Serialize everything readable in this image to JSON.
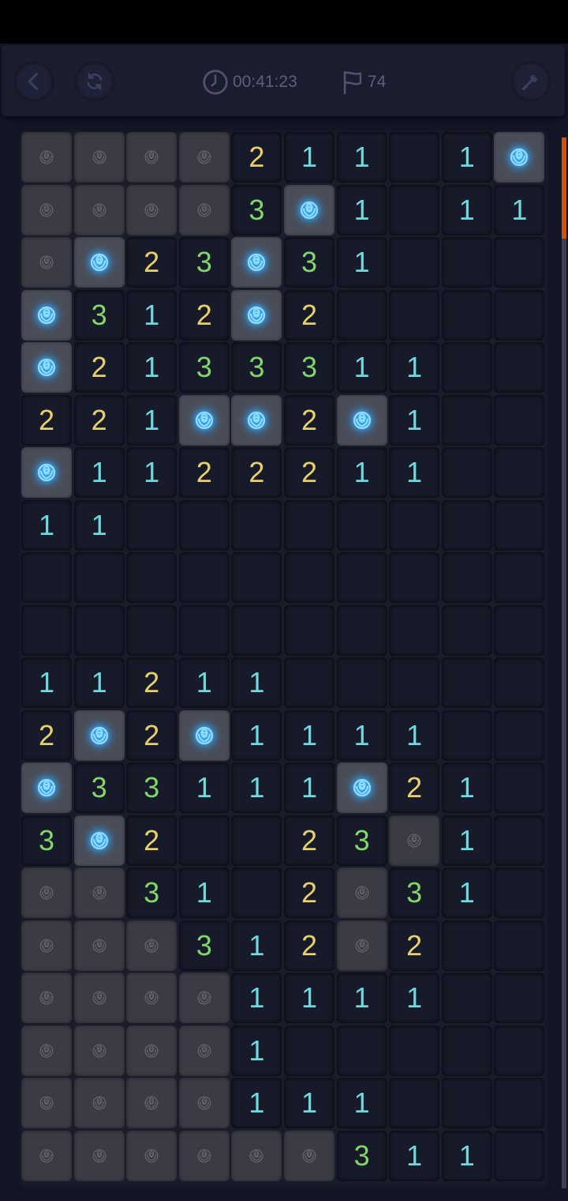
{
  "header": {
    "timer": "00:41:23",
    "flags": "74",
    "back_icon": "back-icon",
    "restart_icon": "restart-icon",
    "clock_icon": "clock-icon",
    "flag_icon": "flag-icon",
    "shovel_icon": "shovel-icon"
  },
  "board": {
    "legend": {
      "c": "covered",
      "m": "revealed-mine",
      "e": "revealed-empty",
      "1-3": "revealed-number"
    },
    "rows": [
      [
        "c",
        "c",
        "c",
        "c",
        "2",
        "1",
        "1",
        "e",
        "1",
        "m"
      ],
      [
        "c",
        "c",
        "c",
        "c",
        "3",
        "m",
        "1",
        "e",
        "1",
        "1"
      ],
      [
        "c",
        "m",
        "2",
        "3",
        "m",
        "3",
        "1",
        "e",
        "e",
        "e"
      ],
      [
        "m",
        "3",
        "1",
        "2",
        "m",
        "2",
        "e",
        "e",
        "e",
        "e"
      ],
      [
        "m",
        "2",
        "1",
        "3",
        "3",
        "3",
        "1",
        "1",
        "e",
        "e"
      ],
      [
        "2",
        "2",
        "1",
        "m",
        "m",
        "2",
        "m",
        "1",
        "e",
        "e"
      ],
      [
        "m",
        "1",
        "1",
        "2",
        "2",
        "2",
        "1",
        "1",
        "e",
        "e"
      ],
      [
        "1",
        "1",
        "e",
        "e",
        "e",
        "e",
        "e",
        "e",
        "e",
        "e"
      ],
      [
        "e",
        "e",
        "e",
        "e",
        "e",
        "e",
        "e",
        "e",
        "e",
        "e"
      ],
      [
        "e",
        "e",
        "e",
        "e",
        "e",
        "e",
        "e",
        "e",
        "e",
        "e"
      ],
      [
        "1",
        "1",
        "2",
        "1",
        "1",
        "e",
        "e",
        "e",
        "e",
        "e"
      ],
      [
        "2",
        "m",
        "2",
        "m",
        "1",
        "1",
        "1",
        "1",
        "e",
        "e"
      ],
      [
        "m",
        "3",
        "3",
        "1",
        "1",
        "1",
        "m",
        "2",
        "1",
        "e"
      ],
      [
        "3",
        "m",
        "2",
        "e",
        "e",
        "2",
        "3",
        "c",
        "1",
        "e"
      ],
      [
        "c",
        "c",
        "3",
        "1",
        "e",
        "2",
        "c",
        "3",
        "1",
        "e"
      ],
      [
        "c",
        "c",
        "c",
        "3",
        "1",
        "2",
        "c",
        "2",
        "e",
        "e"
      ],
      [
        "c",
        "c",
        "c",
        "c",
        "1",
        "1",
        "1",
        "1",
        "e",
        "e"
      ],
      [
        "c",
        "c",
        "c",
        "c",
        "1",
        "e",
        "e",
        "e",
        "e",
        "e"
      ],
      [
        "c",
        "c",
        "c",
        "c",
        "1",
        "1",
        "1",
        "e",
        "e",
        "e"
      ],
      [
        "c",
        "c",
        "c",
        "c",
        "c",
        "c",
        "3",
        "1",
        "1",
        "e"
      ]
    ]
  },
  "colors": {
    "number_1": "#6ed9e0",
    "number_2": "#e8cf6e",
    "number_3": "#82d66c",
    "mine_glow": "#2fa8ff",
    "scroll_thumb": "#c8561b"
  }
}
